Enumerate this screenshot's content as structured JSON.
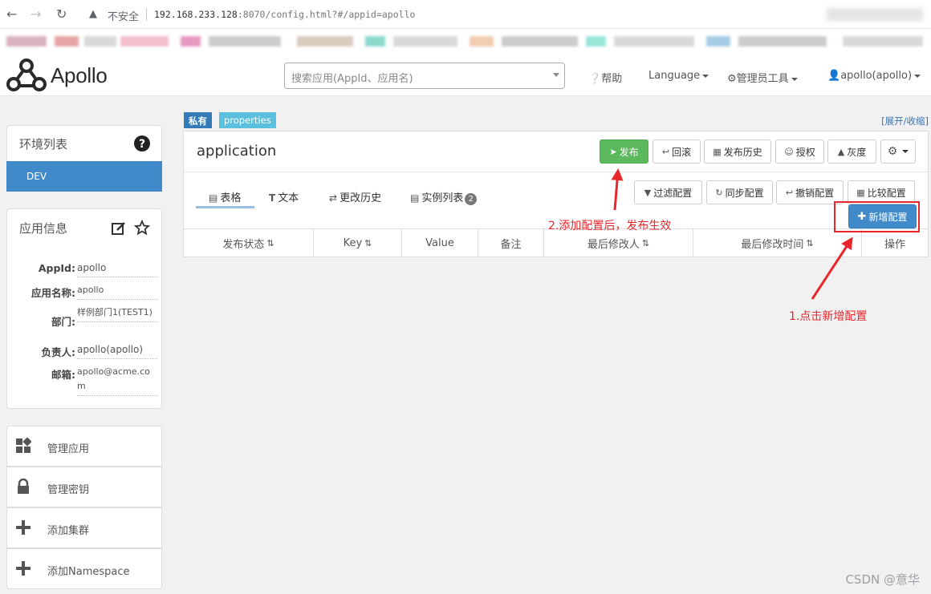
{
  "browser": {
    "warning_text": "不安全",
    "url_host": "192.168.233.128",
    "url_rest": ":8070/config.html?#/appid=apollo"
  },
  "navbar": {
    "brand": "Apollo",
    "search_placeholder": "搜索应用(AppId、应用名)",
    "help": "帮助",
    "language": "Language",
    "admin_tools": "管理员工具",
    "user": "apollo(apollo)"
  },
  "env_panel": {
    "title": "环境列表",
    "environments": [
      "DEV"
    ]
  },
  "app_info": {
    "title": "应用信息",
    "fields": [
      {
        "label": "AppId:",
        "value": "apollo"
      },
      {
        "label": "应用名称:",
        "value": "apollo"
      },
      {
        "label": "部门:",
        "value": "样例部门1(TEST1)"
      },
      {
        "label": "负责人:",
        "value": "apollo(apollo)"
      },
      {
        "label": "邮箱:",
        "value": "apollo@acme.com"
      }
    ]
  },
  "side_menu": [
    {
      "label": "管理应用",
      "icon": "dashboard-icon"
    },
    {
      "label": "管理密钥",
      "icon": "lock-icon"
    },
    {
      "label": "添加集群",
      "icon": "plus-icon"
    },
    {
      "label": "添加Namespace",
      "icon": "plus-icon"
    }
  ],
  "namespace": {
    "badge_private": "私有",
    "badge_format": "properties",
    "expand_collapse": "[展开/收缩]",
    "name": "application",
    "actions": {
      "publish": "发布",
      "rollback": "回滚",
      "publish_history": "发布历史",
      "grant": "授权",
      "gray": "灰度"
    },
    "tabs": [
      {
        "label": "表格",
        "icon": "table-icon"
      },
      {
        "label": "文本",
        "icon": "text-icon"
      },
      {
        "label": "更改历史",
        "icon": "history-icon"
      },
      {
        "label": "实例列表",
        "icon": "instances-icon",
        "count": "2"
      }
    ],
    "tools": {
      "filter": "过滤配置",
      "sync": "同步配置",
      "revoke": "撤销配置",
      "diff": "比较配置",
      "add": "新增配置"
    },
    "columns": [
      {
        "label": "发布状态",
        "sortable": true
      },
      {
        "label": "Key",
        "sortable": true
      },
      {
        "label": "Value",
        "sortable": false
      },
      {
        "label": "备注",
        "sortable": false
      },
      {
        "label": "最后修改人",
        "sortable": true
      },
      {
        "label": "最后修改时间",
        "sortable": true
      },
      {
        "label": "操作",
        "sortable": false
      }
    ]
  },
  "annotations": {
    "step2": "2.添加配置后，发布生效",
    "step1": "1.点击新增配置",
    "color": "#e8262b"
  },
  "watermark": "CSDN @意华",
  "colors": {
    "primary": "#428bca",
    "success": "#5cb85c",
    "badge_private": "#337ab7",
    "badge_format": "#5bc0de"
  }
}
